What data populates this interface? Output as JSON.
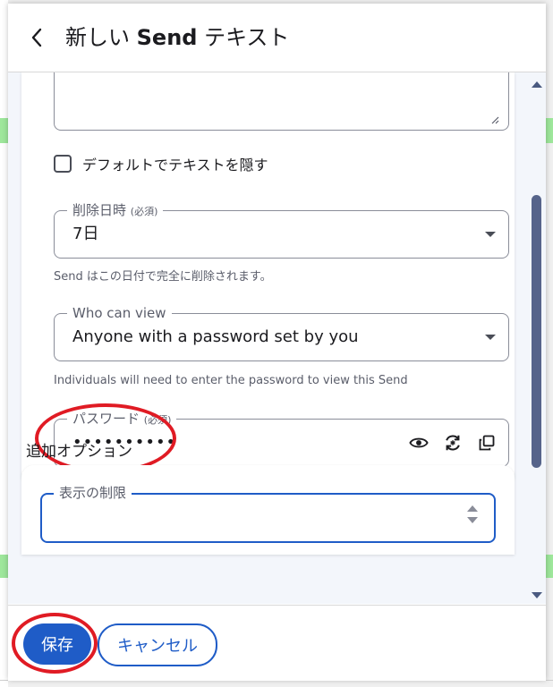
{
  "header": {
    "title_prefix": "新しい ",
    "title_bold": "Send",
    "title_suffix": " テキスト"
  },
  "form": {
    "hide_text_checkbox": {
      "label": "デフォルトでテキストを隠す",
      "checked": false
    },
    "deletion_date": {
      "label": "削除日時",
      "required_tag": "(必須)",
      "value": "7日",
      "hint": "Send はこの日付で完全に削除されます。"
    },
    "who_can_view": {
      "label": "Who can view",
      "value": "Anyone with a password set by you",
      "hint": "Individuals will need to enter the password to view this Send"
    },
    "password": {
      "label": "パスワード",
      "required_tag": "(必須)",
      "value": "••••••••••",
      "icons": [
        "eye-icon",
        "regenerate-icon",
        "copy-icon"
      ]
    },
    "additional_options_heading": "追加オプション",
    "view_limit": {
      "label": "表示の制限",
      "value": ""
    }
  },
  "footer": {
    "save_label": "保存",
    "cancel_label": "キャンセル"
  },
  "colors": {
    "primary": "#1f5cc7",
    "annotation_red": "#e01b24",
    "scroll_thumb": "#56648a"
  }
}
